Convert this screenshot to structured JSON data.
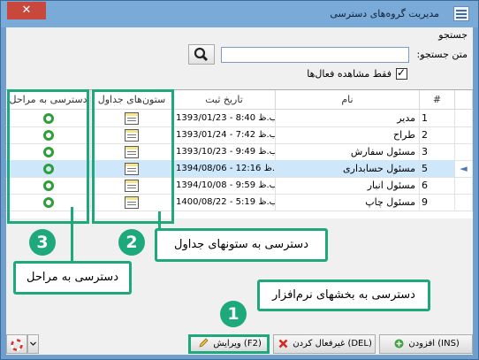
{
  "window": {
    "title": "مدیریت گروه‌های دسترسی",
    "app_icon": "list-window-icon",
    "close_label": "✕"
  },
  "search": {
    "section_label": "جستجو",
    "field_label": "متن جستجو:",
    "value": "",
    "button_icon": "search-icon"
  },
  "filter": {
    "active_only_label": "فقط مشاهده فعال‌ها",
    "checked": true,
    "check_mark": "✓"
  },
  "grid": {
    "columns": {
      "index": "#",
      "name": "نام",
      "date": "تاریخ ثبت",
      "tables": "ستون‌های جداول",
      "stages": "دسترسی به مراحل"
    },
    "row_marker": "◄",
    "rows": [
      {
        "id": "1",
        "name": "مدیر",
        "date": "1393/01/23 - 8:40 ب.ظ",
        "selected": false
      },
      {
        "id": "2",
        "name": "طراح",
        "date": "1393/01/24 - 7:42 ب.ظ",
        "selected": false
      },
      {
        "id": "3",
        "name": "مسئول سفارش",
        "date": "1393/10/23 - 9:49 ب.ظ",
        "selected": false
      },
      {
        "id": "5",
        "name": "مسئول حسابداری",
        "date": "1394/08/06 - 12:16 ق.ظ",
        "selected": true
      },
      {
        "id": "6",
        "name": "مسئول انبار",
        "date": "1394/10/08 - 9:59 ب.ظ",
        "selected": false
      },
      {
        "id": "9",
        "name": "مسئول چاپ",
        "date": "1400/08/22 - 5:19 ب.ظ",
        "selected": false
      }
    ]
  },
  "callouts": {
    "badge_1": "1",
    "badge_2": "2",
    "badge_3": "3",
    "software_sections": "دسترسی به بخشهای نرم‌افزار",
    "table_columns": "دسترسی به ستونهای جداول",
    "stages": "دسترسی به مراحل"
  },
  "buttons": {
    "add": {
      "label": "(INS) افزودن",
      "icon": "plus-circle-icon"
    },
    "deactivate": {
      "label": "(DEL) غیرفعال کردن",
      "icon": "x-mark-icon"
    },
    "edit": {
      "label": "(F2) ویرایش",
      "icon": "pencil-icon"
    },
    "help_icon": "lifebuoy-icon",
    "dropdown_icon": "chevron-down-icon"
  },
  "colors": {
    "accent": "#1ea97c",
    "selection": "#cfe7fa",
    "titlebar": "#7aaad8",
    "close": "#c8483d"
  }
}
